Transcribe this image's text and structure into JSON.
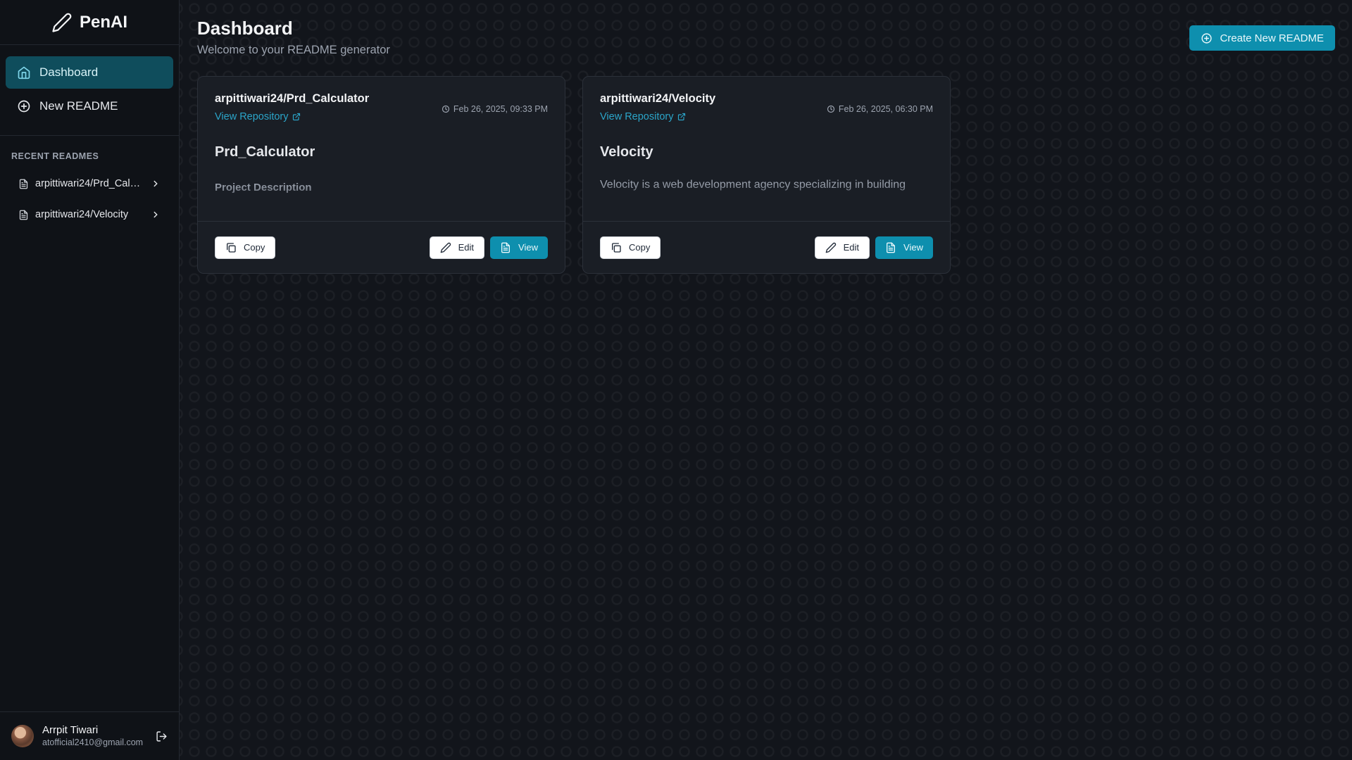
{
  "brand": {
    "name": "PenAI"
  },
  "nav": [
    {
      "label": "Dashboard",
      "icon": "home-icon",
      "active": true
    },
    {
      "label": "New README",
      "icon": "plus-circle-icon",
      "active": false
    }
  ],
  "recent": {
    "title": "RECENT READMES",
    "items": [
      {
        "label": "arpittiwari24/Prd_Calcu..."
      },
      {
        "label": "arpittiwari24/Velocity"
      }
    ]
  },
  "user": {
    "name": "Arrpit Tiwari",
    "email": "atofficial2410@gmail.com"
  },
  "header": {
    "title": "Dashboard",
    "subtitle": "Welcome to your README generator",
    "create_label": "Create New README"
  },
  "cards": [
    {
      "repo": "arpittiwari24/Prd_Calculator",
      "date": "Feb 26, 2025, 09:33 PM",
      "link_label": "View Repository",
      "preview_title": "Prd_Calculator",
      "preview_sub": "Project Description",
      "copy_label": "Copy",
      "edit_label": "Edit",
      "view_label": "View"
    },
    {
      "repo": "arpittiwari24/Velocity",
      "date": "Feb 26, 2025, 06:30 PM",
      "link_label": "View Repository",
      "preview_title": "Velocity",
      "preview_text": "Velocity is a web development agency specializing in building",
      "copy_label": "Copy",
      "edit_label": "Edit",
      "view_label": "View"
    }
  ],
  "colors": {
    "accent": "#0e8fae",
    "link": "#2ba5c9",
    "active_nav": "#0f4d5c"
  }
}
